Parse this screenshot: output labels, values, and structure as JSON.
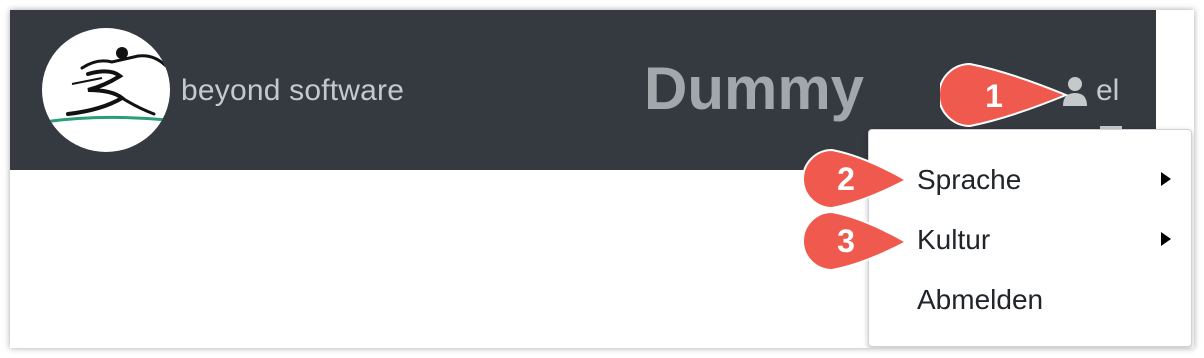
{
  "header": {
    "brand": "beyond software",
    "title": "Dummy",
    "user": "el",
    "background": "#343a40"
  },
  "menu": {
    "items": [
      {
        "label": "Sprache",
        "submenu": true
      },
      {
        "label": "Kultur",
        "submenu": true
      },
      {
        "label": "Abmelden",
        "submenu": false
      }
    ]
  },
  "callouts": [
    {
      "number": "1"
    },
    {
      "number": "2"
    },
    {
      "number": "3"
    }
  ],
  "colors": {
    "callout": "#f05a4e",
    "logo_stripe": "#2a9d7a"
  },
  "icons": {
    "user": "user-icon",
    "submenu": "caret-right-icon"
  }
}
